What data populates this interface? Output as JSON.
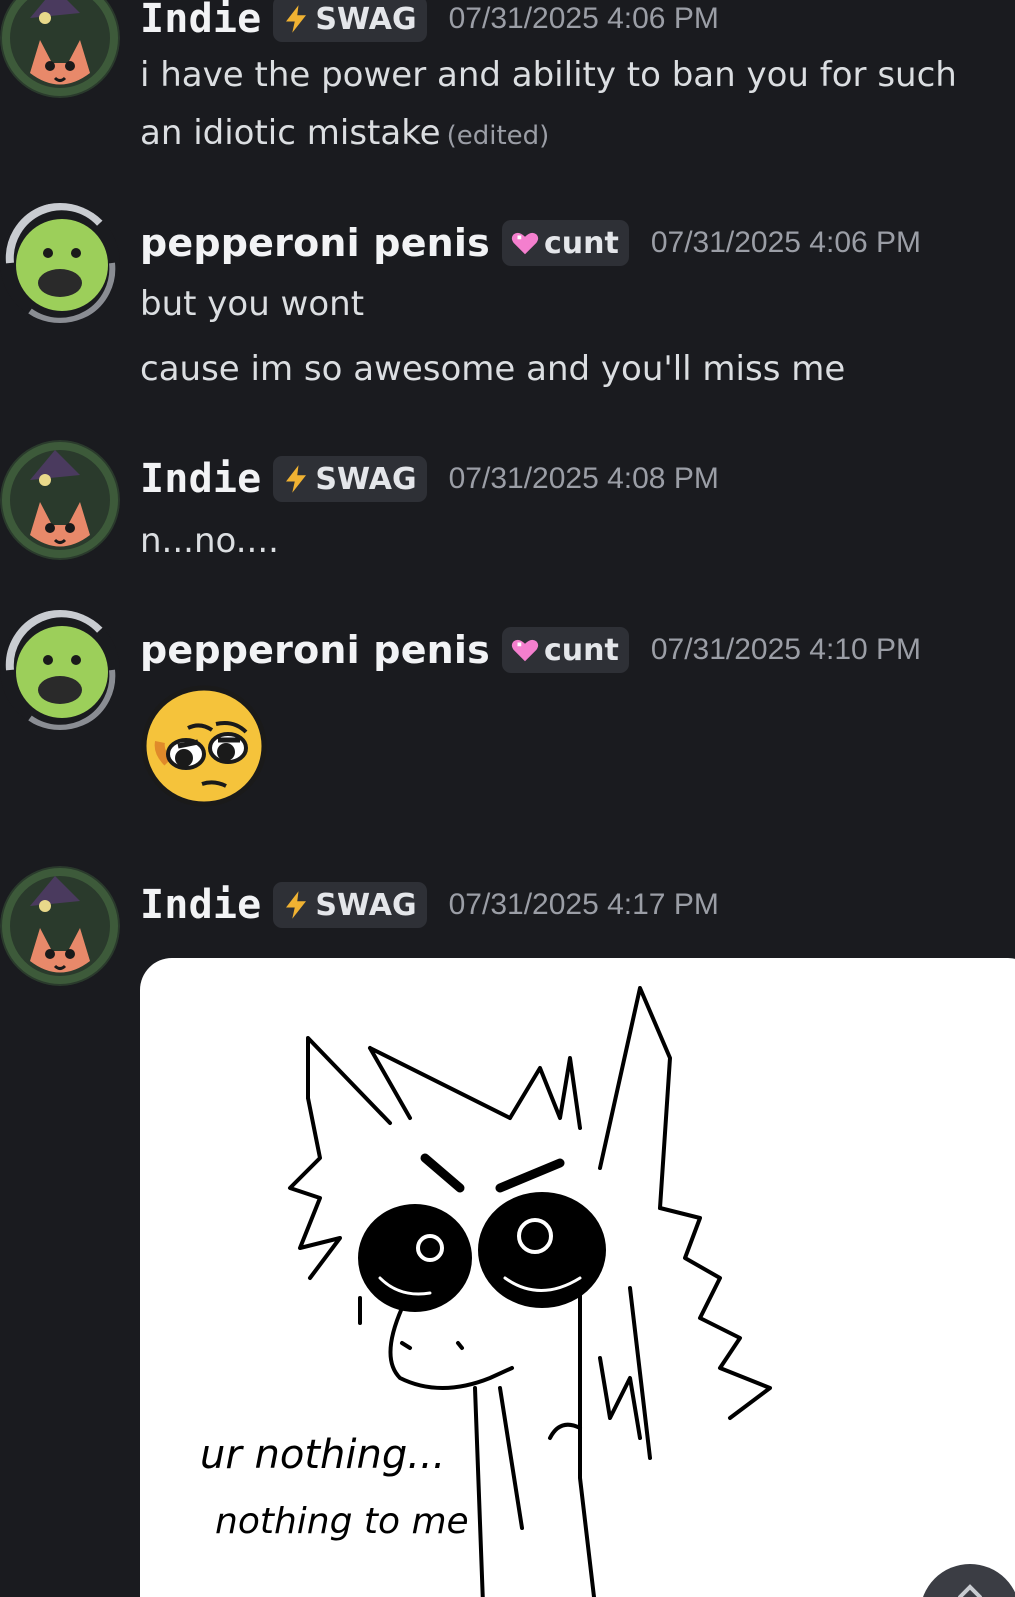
{
  "messages": [
    {
      "author": "Indie",
      "role_tag": "SWAG",
      "role_icon": "lightning-icon",
      "timestamp": "07/31/2025 4:06 PM",
      "lines": [
        "i have the power and ability to ban you for such",
        "an idiotic mistake"
      ],
      "edited_label": "(edited)"
    },
    {
      "author": "pepperoni penis",
      "role_tag": "cunt",
      "role_icon": "pink-heart-icon",
      "timestamp": "07/31/2025 4:06 PM",
      "lines": [
        "but you wont",
        "cause im so awesome and you'll miss me"
      ]
    },
    {
      "author": "Indie",
      "role_tag": "SWAG",
      "role_icon": "lightning-icon",
      "timestamp": "07/31/2025 4:08 PM",
      "lines": [
        "n...no...."
      ]
    },
    {
      "author": "pepperoni penis",
      "role_tag": "cunt",
      "role_icon": "pink-heart-icon",
      "timestamp": "07/31/2025 4:10 PM",
      "attachment": "pleading-smug-emoji"
    },
    {
      "author": "Indie",
      "role_tag": "SWAG",
      "role_icon": "lightning-icon",
      "timestamp": "07/31/2025 4:17 PM",
      "attachment": "drawing-image",
      "drawing_caption_lines": [
        "ur nothing...",
        "nothing to me"
      ]
    }
  ],
  "jump_button_icon": "chevron-up-icon",
  "colors": {
    "background": "#1a1b1f",
    "tag_background": "#2e3036",
    "username": "#f2f3f5",
    "timestamp": "#9b9ea6",
    "text": "#dbdee1",
    "lightning": "#f0b232",
    "heart": "#f47fce"
  }
}
